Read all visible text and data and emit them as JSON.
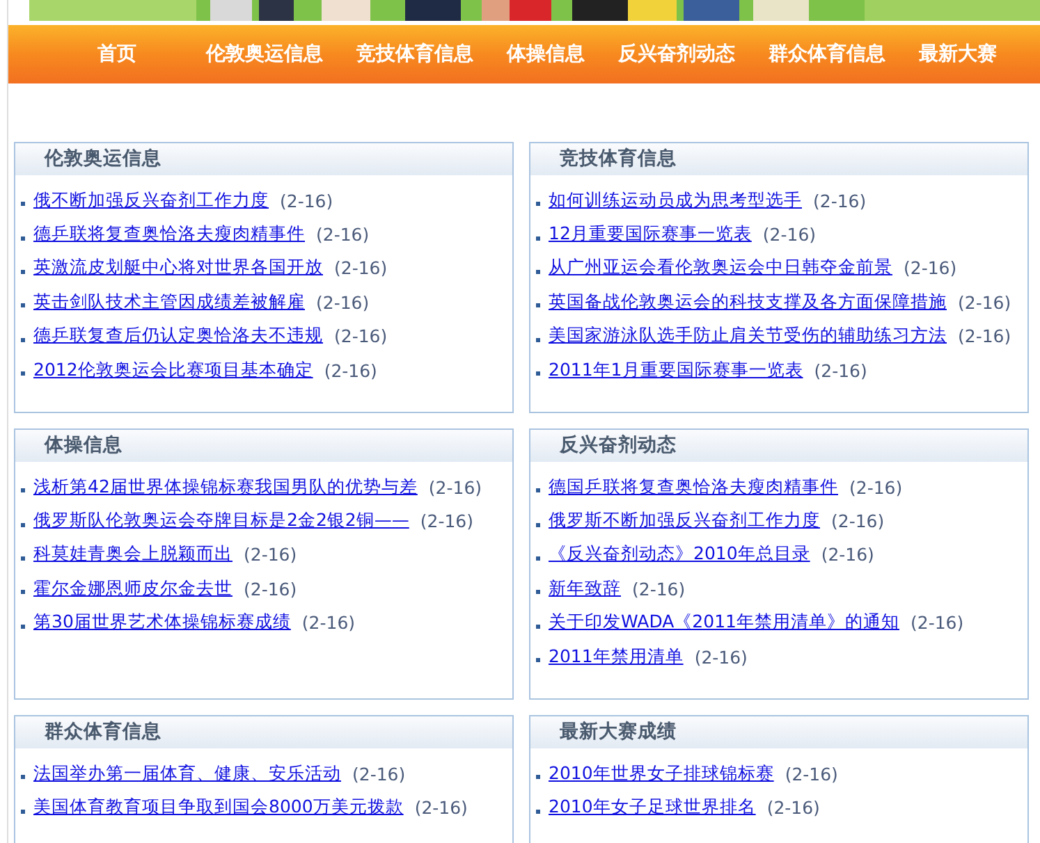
{
  "nav": [
    "首页",
    "伦敦奥运信息",
    "竞技体育信息",
    "体操信息",
    "反兴奋剂动态",
    "群众体育信息",
    "最新大赛"
  ],
  "panels": [
    {
      "title": "伦敦奥运信息",
      "items": [
        {
          "text": "俄不断加强反兴奋剂工作力度",
          "date": "(2-16)"
        },
        {
          "text": "德乒联将复查奥恰洛夫瘦肉精事件",
          "date": "(2-16)"
        },
        {
          "text": "英激流皮划艇中心将对世界各国开放",
          "date": "(2-16)"
        },
        {
          "text": "英击剑队技术主管因成绩差被解雇",
          "date": "(2-16)"
        },
        {
          "text": "德乒联复查后仍认定奥恰洛夫不违规",
          "date": "(2-16)"
        },
        {
          "text": "2012伦敦奥运会比赛项目基本确定",
          "date": "(2-16)"
        }
      ]
    },
    {
      "title": "竞技体育信息",
      "items": [
        {
          "text": "如何训练运动员成为思考型选手 ",
          "date": "(2-16)"
        },
        {
          "text": "12月重要国际赛事一览表",
          "date": "(2-16)"
        },
        {
          "text": "从广州亚运会看伦敦奥运会中日韩夺金前景",
          "date": "(2-16)"
        },
        {
          "text": "英国备战伦敦奥运会的科技支撑及各方面保障措施",
          "date": "(2-16)"
        },
        {
          "text": "美国家游泳队选手防止肩关节受伤的辅助练习方法",
          "date": "(2-16)"
        },
        {
          "text": "2011年1月重要国际赛事一览表",
          "date": "(2-16)"
        }
      ]
    },
    {
      "title": "体操信息",
      "items": [
        {
          "text": "浅析第42届世界体操锦标赛我国男队的优势与差",
          "date": "(2-16)"
        },
        {
          "text": "俄罗斯队伦敦奥运会夺牌目标是2金2银2铜——",
          "date": "(2-16)"
        },
        {
          "text": "科莫娃青奥会上脱颖而出",
          "date": "(2-16)"
        },
        {
          "text": "霍尔金娜恩师皮尔金去世",
          "date": "(2-16)"
        },
        {
          "text": "第30届世界艺术体操锦标赛成绩",
          "date": "(2-16)"
        }
      ]
    },
    {
      "title": "反兴奋剂动态",
      "items": [
        {
          "text": "德国乒联将复查奥恰洛夫瘦肉精事件",
          "date": "(2-16)"
        },
        {
          "text": "俄罗斯不断加强反兴奋剂工作力度",
          "date": "(2-16)"
        },
        {
          "text": "《反兴奋剂动态》2010年总目录",
          "date": "(2-16)"
        },
        {
          "text": "新年致辞",
          "date": "(2-16)"
        },
        {
          "text": "关于印发WADA《2011年禁用清单》的通知",
          "date": "(2-16)"
        },
        {
          "text": "2011年禁用清单",
          "date": "(2-16)"
        }
      ]
    },
    {
      "title": "群众体育信息",
      "items": [
        {
          "text": "法国举办第一届体育、健康、安乐活动",
          "date": "(2-16)"
        },
        {
          "text": "美国体育教育项目争取到国会8000万美元拨款",
          "date": "(2-16)"
        }
      ]
    },
    {
      "title": "最新大赛成绩",
      "items": [
        {
          "text": "2010年世界女子排球锦标赛",
          "date": "(2-16)"
        },
        {
          "text": "2010年女子足球世界排名",
          "date": "(2-16)"
        }
      ]
    }
  ]
}
